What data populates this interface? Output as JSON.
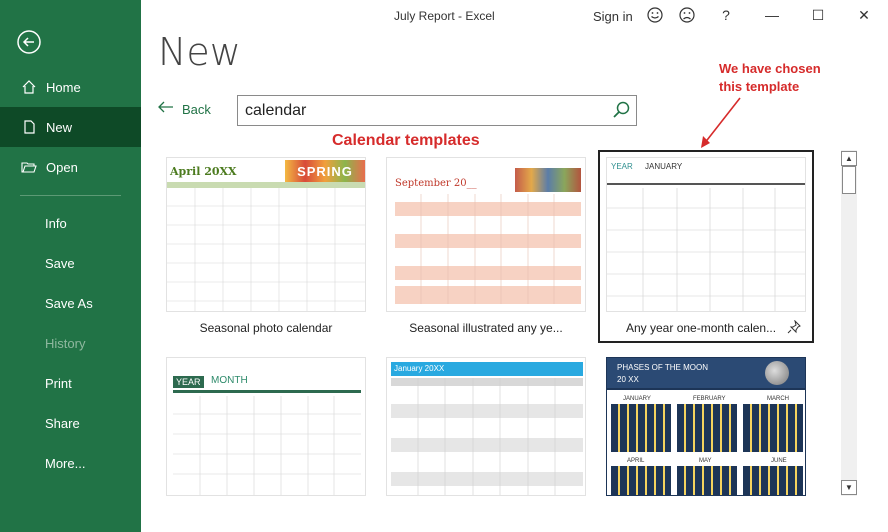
{
  "window": {
    "title": "July Report  -  Excel",
    "sign_in": "Sign in",
    "icons": [
      "smiley-icon",
      "frown-icon",
      "help-icon",
      "minimize-icon",
      "maximize-icon",
      "close-icon"
    ],
    "help_glyph": "?",
    "minimize_glyph": "—",
    "maximize_glyph": "☐",
    "close_glyph": "✕"
  },
  "sidebar": {
    "background": "#217346",
    "items": [
      {
        "label": "Home",
        "icon": "home-icon"
      },
      {
        "label": "New",
        "icon": "new-document-icon",
        "active": true
      },
      {
        "label": "Open",
        "icon": "open-folder-icon"
      },
      {
        "label": "Info"
      },
      {
        "label": "Save"
      },
      {
        "label": "Save As"
      },
      {
        "label": "History",
        "disabled": true
      },
      {
        "label": "Print"
      },
      {
        "label": "Share"
      },
      {
        "label": "More..."
      }
    ]
  },
  "main": {
    "title": "New",
    "back_label": "Back",
    "search": {
      "value": "calendar"
    }
  },
  "annotations": {
    "calendar_templates": "Calendar templates",
    "chosen_line1": "We have chosen",
    "chosen_line2": "this template"
  },
  "templates": [
    {
      "name": "Seasonal photo calendar",
      "thumb_title": "April 20XX",
      "banner": "SPRING"
    },
    {
      "name": "Seasonal illustrated any ye...",
      "thumb_title": "September 20__"
    },
    {
      "name": "Any year one-month calen...",
      "thumb_year": "YEAR",
      "thumb_month": "JANUARY",
      "selected": true
    },
    {
      "name": "",
      "thumb_year": "YEAR",
      "thumb_month": "MONTH"
    },
    {
      "name": "",
      "thumb_title": "January 20XX"
    },
    {
      "name": "",
      "thumb_title": "PHASES OF THE MOON",
      "thumb_sub": "20 XX",
      "months": [
        "JANUARY",
        "FEBRUARY",
        "MARCH",
        "APRIL",
        "MAY",
        "JUNE"
      ]
    }
  ],
  "accent_colors": {
    "green": "#217346",
    "annotation_red": "#d62b2b"
  }
}
